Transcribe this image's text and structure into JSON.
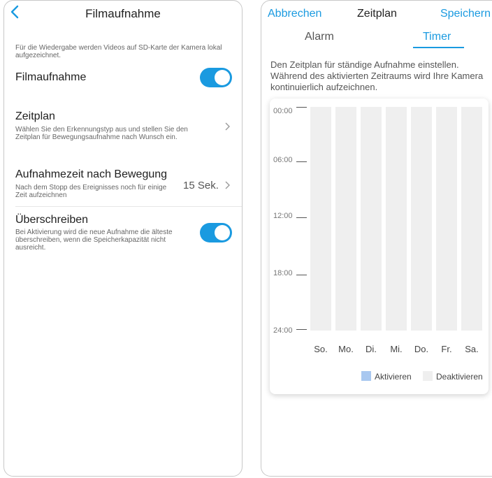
{
  "left": {
    "title": "Filmaufnahme",
    "intro": "Für die Wiedergabe werden Videos auf SD-Karte der Kamera lokal aufgezeichnet.",
    "recording": {
      "label": "Filmaufnahme",
      "enabled": true
    },
    "schedule": {
      "label": "Zeitplan",
      "description": "Wählen Sie den Erkennungstyp aus und stellen Sie den Zeitplan für Bewegungsaufnahme nach Wunsch ein."
    },
    "post_motion": {
      "label": "Aufnahmezeit nach Bewegung",
      "description": "Nach dem Stopp des Ereignisses noch für einige Zeit aufzeichnen",
      "value": "15 Sek."
    },
    "overwrite": {
      "label": "Überschreiben",
      "description": "Bei Aktivierung wird die neue Aufnahme die älteste überschreiben, wenn die Speicherkapazität nicht ausreicht.",
      "enabled": true
    }
  },
  "right": {
    "cancel": "Abbrechen",
    "title": "Zeitplan",
    "save": "Speichern",
    "tabs": [
      {
        "label": "Alarm",
        "active": false
      },
      {
        "label": "Timer",
        "active": true
      }
    ],
    "description": "Den Zeitplan für ständige Aufnahme einstellen. Während des aktivierten Zeitraums wird Ihre Kamera kontinuierlich aufzeichnen.",
    "times": [
      "00:00",
      "06:00",
      "12:00",
      "18:00",
      "24:00"
    ],
    "days": [
      "So.",
      "Mo.",
      "Di.",
      "Mi.",
      "Do.",
      "Fr.",
      "Sa."
    ],
    "legend": {
      "activate": "Aktivieren",
      "deactivate": "Deaktivieren",
      "activate_color": "#a9c8f0",
      "deactivate_color": "#efefef"
    }
  },
  "colors": {
    "accent": "#1a9ae0"
  }
}
